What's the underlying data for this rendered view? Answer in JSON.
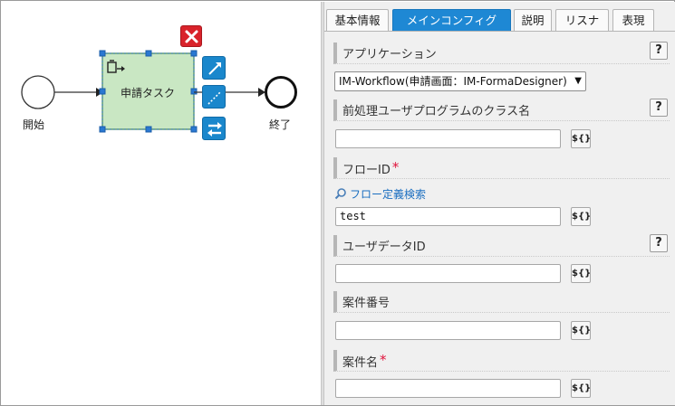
{
  "canvas": {
    "start_label": "開始",
    "task_label": "申請タスク",
    "end_label": "終了"
  },
  "tabs": [
    {
      "label": "基本情報",
      "active": false
    },
    {
      "label": "メインコンフィグ",
      "active": true
    },
    {
      "label": "説明",
      "active": false
    },
    {
      "label": "リスナ",
      "active": false
    },
    {
      "label": "表現",
      "active": false
    }
  ],
  "fields": {
    "application": {
      "label": "アプリケーション",
      "help": "?",
      "selected": "IM-Workflow(申請画面：IM-FormaDesigner)",
      "arrow": "▼"
    },
    "preprocess": {
      "label": "前処理ユーザプログラムのクラス名",
      "help": "?",
      "value": "",
      "var_button": "${}"
    },
    "flow_id": {
      "label": "フローID",
      "required": "*",
      "search_link": "フロー定義検索",
      "value": "test",
      "var_button": "${}"
    },
    "user_data_id": {
      "label": "ユーザデータID",
      "help": "?",
      "value": "",
      "var_button": "${}"
    },
    "matter_number": {
      "label": "案件番号",
      "value": "",
      "var_button": "${}"
    },
    "matter_name": {
      "label": "案件名",
      "required": "*",
      "value": "",
      "var_button": "${}"
    }
  },
  "colors": {
    "accent": "#1e88d4",
    "task_fill": "#c9e7c3",
    "task_border": "#4d8f6a",
    "delete": "#d9232b",
    "required": "#e0143c",
    "link": "#1a6ec0"
  },
  "icons": [
    "close-icon",
    "clipboard-arrow-icon",
    "straight-line-icon",
    "dashed-line-icon",
    "swap-icon",
    "magnifier-icon"
  ]
}
